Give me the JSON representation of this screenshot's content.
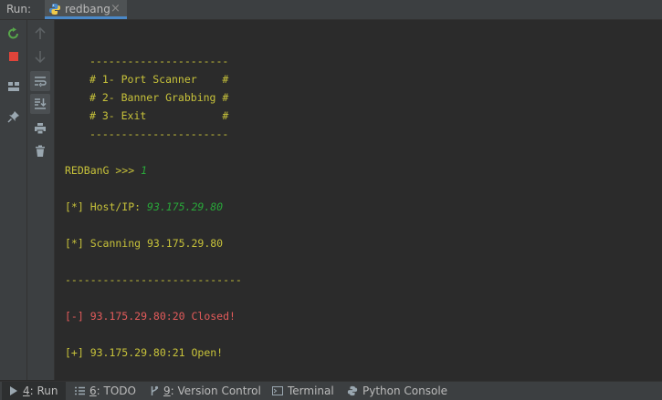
{
  "header": {
    "run_label": "Run:",
    "tab_title": "redbang"
  },
  "console_lines": {
    "dashes_top": "----------------------",
    "menu1": "# 1- Port Scanner    #",
    "menu2": "# 2- Banner Grabbing #",
    "menu3": "# 3- Exit            #",
    "dashes_bottom": "----------------------",
    "prompt": "REDBanG >>> ",
    "prompt_input": "1",
    "host_label": "[*] Host/IP: ",
    "host_input": "93.175.29.80",
    "scanning": "[*] Scanning 93.175.29.80",
    "separator": "----------------------------",
    "closed": "[-] 93.175.29.80:20 Closed!",
    "open": "[+] 93.175.29.80:21 Open!"
  },
  "bottom_tabs": [
    {
      "num": "4",
      "label": ": Run",
      "icon": "play-icon"
    },
    {
      "num": "6",
      "label": ": TODO",
      "icon": "list-icon"
    },
    {
      "num": "9",
      "label": ": Version Control",
      "icon": "vcs-icon"
    },
    {
      "num": "",
      "label": "Terminal",
      "icon": "terminal-icon"
    },
    {
      "num": "",
      "label": "Python Console",
      "icon": "python-icon"
    }
  ],
  "colors": {
    "accent": "#4a88c7",
    "console_text": "#c7c23a",
    "input_green": "#29a83a",
    "error_red": "#e35b5b"
  }
}
